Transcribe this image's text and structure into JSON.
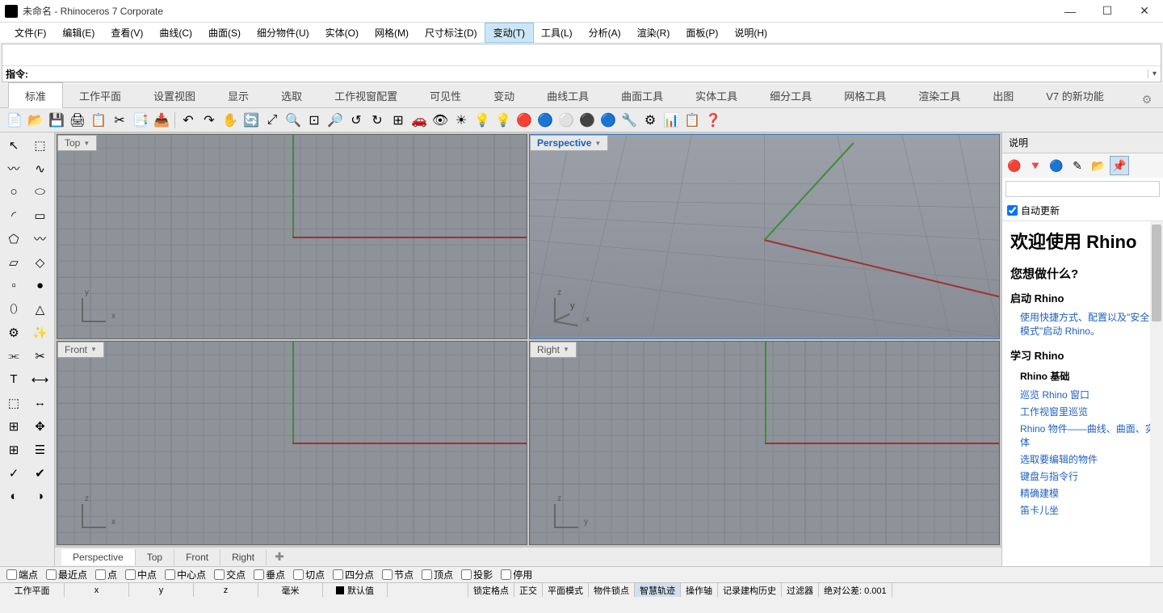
{
  "window": {
    "title": "未命名 - Rhinoceros 7 Corporate",
    "minimize": "—",
    "maximize": "☐",
    "close": "✕"
  },
  "menubar": [
    "文件(F)",
    "编辑(E)",
    "查看(V)",
    "曲线(C)",
    "曲面(S)",
    "细分物件(U)",
    "实体(O)",
    "网格(M)",
    "尺寸标注(D)",
    "变动(T)",
    "工具(L)",
    "分析(A)",
    "渲染(R)",
    "面板(P)",
    "说明(H)"
  ],
  "menubar_hover_index": 9,
  "command": {
    "prompt": "指令:"
  },
  "tooltabs": [
    "标准",
    "工作平面",
    "设置视图",
    "显示",
    "选取",
    "工作视窗配置",
    "可见性",
    "变动",
    "曲线工具",
    "曲面工具",
    "实体工具",
    "细分工具",
    "网格工具",
    "渲染工具",
    "出图",
    "V7 的新功能"
  ],
  "toolbar_icons": [
    {
      "n": "new-icon",
      "g": "📄"
    },
    {
      "n": "open-icon",
      "g": "📂"
    },
    {
      "n": "save-icon",
      "g": "💾"
    },
    {
      "n": "print-icon",
      "g": "🖨"
    },
    {
      "n": "export-icon",
      "g": "📋"
    },
    {
      "n": "cut-icon",
      "g": "✂"
    },
    {
      "n": "copy-icon",
      "g": "📑"
    },
    {
      "n": "paste-icon",
      "g": "📥"
    },
    {
      "n": "sep",
      "g": ""
    },
    {
      "n": "undo-icon",
      "g": "↶"
    },
    {
      "n": "redo-icon",
      "g": "↷"
    },
    {
      "n": "pan-icon",
      "g": "✋"
    },
    {
      "n": "rotate-icon",
      "g": "🔄"
    },
    {
      "n": "zoom-extents-icon",
      "g": "⤢"
    },
    {
      "n": "zoom-window-icon",
      "g": "🔍"
    },
    {
      "n": "zoom-sel-icon",
      "g": "⊡"
    },
    {
      "n": "zoom-icon",
      "g": "🔎"
    },
    {
      "n": "undo-view-icon",
      "g": "↺"
    },
    {
      "n": "redo-view-icon",
      "g": "↻"
    },
    {
      "n": "four-view-icon",
      "g": "⊞"
    },
    {
      "n": "car-icon",
      "g": "🚗"
    },
    {
      "n": "named-view-icon",
      "g": "👁"
    },
    {
      "n": "sun-icon",
      "g": "☀"
    },
    {
      "n": "light-icon",
      "g": "💡"
    },
    {
      "n": "bulb-icon",
      "g": "💡"
    },
    {
      "n": "render-icon",
      "g": "🔴"
    },
    {
      "n": "material-icon",
      "g": "🔵"
    },
    {
      "n": "sphere1-icon",
      "g": "⚪"
    },
    {
      "n": "sphere2-icon",
      "g": "⚫"
    },
    {
      "n": "environment-icon",
      "g": "🔵"
    },
    {
      "n": "options-icon",
      "g": "🔧"
    },
    {
      "n": "gear2-icon",
      "g": "⚙"
    },
    {
      "n": "layers-icon",
      "g": "📊"
    },
    {
      "n": "properties-icon",
      "g": "📋"
    },
    {
      "n": "help-icon",
      "g": "❓"
    }
  ],
  "left_tools": [
    {
      "n": "pointer-icon",
      "g": "↖"
    },
    {
      "n": "lasso-icon",
      "g": "⬚"
    },
    {
      "n": "polyline-icon",
      "g": "〰"
    },
    {
      "n": "curve-icon",
      "g": "∿"
    },
    {
      "n": "circle-icon",
      "g": "○"
    },
    {
      "n": "ellipse-icon",
      "g": "⬭"
    },
    {
      "n": "arc-icon",
      "g": "◜"
    },
    {
      "n": "rectangle-icon",
      "g": "▭"
    },
    {
      "n": "polygon-icon",
      "g": "⬠"
    },
    {
      "n": "freeform-icon",
      "g": "〰"
    },
    {
      "n": "surface-icon",
      "g": "▱"
    },
    {
      "n": "plane-icon",
      "g": "◇"
    },
    {
      "n": "box-icon",
      "g": "▫"
    },
    {
      "n": "sphere-icon",
      "g": "●"
    },
    {
      "n": "cylinder-icon",
      "g": "⬯"
    },
    {
      "n": "cone-icon",
      "g": "△"
    },
    {
      "n": "gear-icon",
      "g": "⚙"
    },
    {
      "n": "explode-icon",
      "g": "✨"
    },
    {
      "n": "join-icon",
      "g": "⫘"
    },
    {
      "n": "trim-icon",
      "g": "✂"
    },
    {
      "n": "text-icon",
      "g": "T"
    },
    {
      "n": "dim-icon",
      "g": "⟷"
    },
    {
      "n": "align-icon",
      "g": "⬚"
    },
    {
      "n": "transform-icon",
      "g": "↔"
    },
    {
      "n": "array-icon",
      "g": "⊞"
    },
    {
      "n": "move-icon",
      "g": "✥"
    },
    {
      "n": "grid-icon",
      "g": "⊞"
    },
    {
      "n": "layer-icon",
      "g": "☰"
    },
    {
      "n": "check-icon",
      "g": "✓"
    },
    {
      "n": "tick-icon",
      "g": "✔"
    },
    {
      "n": "more1-icon",
      "g": "◐"
    },
    {
      "n": "more2-icon",
      "g": "◑"
    }
  ],
  "viewports": {
    "top": {
      "label": "Top",
      "axis_v": "y",
      "axis_h": "x"
    },
    "persp": {
      "label": "Perspective",
      "axis_v": "z",
      "axis_h": "x",
      "axis_3": "y"
    },
    "front": {
      "label": "Front",
      "axis_v": "z",
      "axis_h": "x"
    },
    "right": {
      "label": "Right",
      "axis_v": "z",
      "axis_h": "y"
    }
  },
  "viewtabs": [
    "Perspective",
    "Top",
    "Front",
    "Right"
  ],
  "rightpanel": {
    "title": "说明",
    "auto_update": "自动更新",
    "h1": "欢迎使用 Rhino",
    "h2": "您想做什么?",
    "sec1_title": "启动 Rhino",
    "sec1_link": "使用快捷方式、配置以及\"安全模式\"启动 Rhino。",
    "sec2_title": "学习 Rhino",
    "sec2_sub": "Rhino 基础",
    "links": [
      "巡览 Rhino 窗口",
      "工作视窗里巡览",
      "Rhino 物件——曲线、曲面、实体",
      "选取要编辑的物件",
      "键盘与指令行",
      "精确建模",
      "笛卡儿坐"
    ],
    "icons": [
      {
        "n": "help-circle-icon",
        "g": "🔴"
      },
      {
        "n": "help-wedge-icon",
        "g": "🔻"
      },
      {
        "n": "help-sphere-icon",
        "g": "🔵"
      },
      {
        "n": "help-pen-icon",
        "g": "✎"
      },
      {
        "n": "help-folder-icon",
        "g": "📂"
      },
      {
        "n": "help-pin-icon",
        "g": "📌"
      }
    ]
  },
  "osnap": {
    "items": [
      "端点",
      "最近点",
      "点",
      "中点",
      "中心点",
      "交点",
      "垂点",
      "切点",
      "四分点",
      "节点",
      "顶点",
      "投影",
      "停用"
    ]
  },
  "statusbar": {
    "cplane": "工作平面",
    "x": "x",
    "y": "y",
    "z": "z",
    "units": "毫米",
    "layer": "默认值",
    "toggles": [
      "锁定格点",
      "正交",
      "平面模式",
      "物件锁点",
      "智慧轨迹",
      "操作轴",
      "记录建构历史",
      "过滤器"
    ],
    "active_toggle_index": 4,
    "tolerance": "绝对公差: 0.001"
  }
}
